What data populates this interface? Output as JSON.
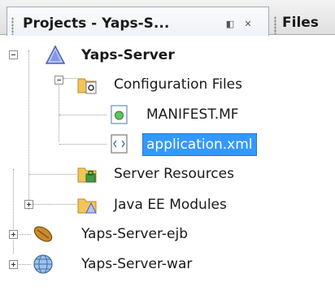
{
  "tabs": {
    "active_title": "Projects - Yaps-S...",
    "inactive_title": "Files",
    "minimize_glyph": "◧",
    "close_glyph": "✕"
  },
  "tree": {
    "root": "Yaps-Server",
    "configuration_files": "Configuration Files",
    "manifest": "MANIFEST.MF",
    "application_xml": "application.xml",
    "server_resources": "Server Resources",
    "java_ee_modules": "Java EE Modules",
    "ejb_project": "Yaps-Server-ejb",
    "war_project": "Yaps-Server-war"
  },
  "colors": {
    "selection": "#3399ff",
    "folder": "#f2c45a",
    "accent": "#7a8fd8"
  }
}
